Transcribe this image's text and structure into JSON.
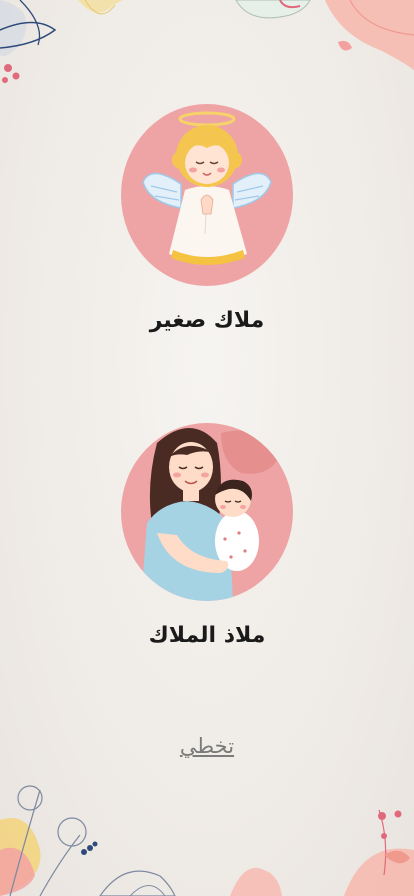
{
  "options": [
    {
      "label": "ملاك صغير",
      "icon": "angel-icon"
    },
    {
      "label": "ملاذ الملاك",
      "icon": "mother-baby-icon"
    }
  ],
  "skip_label": "تخطي",
  "colors": {
    "background": "#efebe6",
    "avatar_bg": "#eea4a4",
    "label": "#1a1a1a",
    "skip": "#7b7b7b"
  }
}
